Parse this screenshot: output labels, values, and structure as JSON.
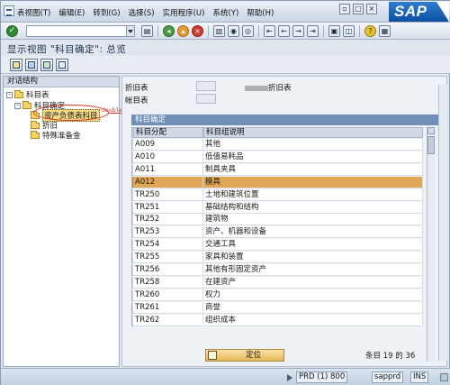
{
  "menu": {
    "items": [
      "表视图(T)",
      "编辑(E)",
      "转到(G)",
      "选择(S)",
      "实用程序(U)",
      "系统(Y)",
      "帮助(H)"
    ]
  },
  "window_buttons": [
    "▫",
    "□",
    "×"
  ],
  "brand": "SAP",
  "toolbar": {
    "command_value": "",
    "icons": [
      "back-icon",
      "exit-icon",
      "cancel-icon",
      "save-icon",
      "print-icon",
      "find-icon",
      "find-next-icon",
      "first-page-icon",
      "prev-page-icon",
      "next-page-icon",
      "last-page-icon",
      "new-session-icon",
      "shortcut-icon",
      "help-icon",
      "layout-icon"
    ]
  },
  "title": "显示视图 \"科目确定\": 总览",
  "left_panel": {
    "header": "对话结构",
    "tree": [
      {
        "label": "科目表",
        "level": 0,
        "toggle": "-",
        "selected": false
      },
      {
        "label": "科目确定",
        "level": 1,
        "toggle": "-",
        "selected": false
      },
      {
        "label": "资产负债表科目",
        "level": 2,
        "toggle": "",
        "selected": true
      },
      {
        "label": "折旧",
        "level": 2,
        "toggle": "",
        "selected": false
      },
      {
        "label": "特殊准备金",
        "level": 2,
        "toggle": "",
        "selected": false
      }
    ],
    "annotation": "double check"
  },
  "header_fields": {
    "depreciation_chart_label": "折旧表",
    "depreciation_chart_value": "",
    "depreciation_chart_desc": "折旧表",
    "chart_of_accounts_label": "帐目表",
    "chart_of_accounts_value": ""
  },
  "table": {
    "title": "科目确定",
    "columns": [
      "科目分配",
      "科目组说明"
    ],
    "rows": [
      {
        "code": "A009",
        "desc": "其他"
      },
      {
        "code": "A010",
        "desc": "低值易耗品"
      },
      {
        "code": "A011",
        "desc": "制具夹具"
      },
      {
        "code": "A012",
        "desc": "模具"
      },
      {
        "code": "TR250",
        "desc": "土地和建筑位置"
      },
      {
        "code": "TR251",
        "desc": "基础结构和结构"
      },
      {
        "code": "TR252",
        "desc": "建筑物"
      },
      {
        "code": "TR253",
        "desc": "资产、机器和设备"
      },
      {
        "code": "TR254",
        "desc": "交通工具"
      },
      {
        "code": "TR255",
        "desc": "家具和装置"
      },
      {
        "code": "TR256",
        "desc": "其他有形固定资产"
      },
      {
        "code": "TR258",
        "desc": "在建资产"
      },
      {
        "code": "TR260",
        "desc": "权力"
      },
      {
        "code": "TR261",
        "desc": "商誉"
      },
      {
        "code": "TR262",
        "desc": "组织成本"
      }
    ],
    "highlighted_row": 3
  },
  "position_button": "定位",
  "entry_count": "条目 19 的 36",
  "status": {
    "system": "PRD (1) 800",
    "server": "sapprd",
    "mode": "INS"
  },
  "colors": {
    "highlight": "#e0a756",
    "table_title_bg": "#6f8fb7",
    "annotation": "#d23b2b"
  }
}
